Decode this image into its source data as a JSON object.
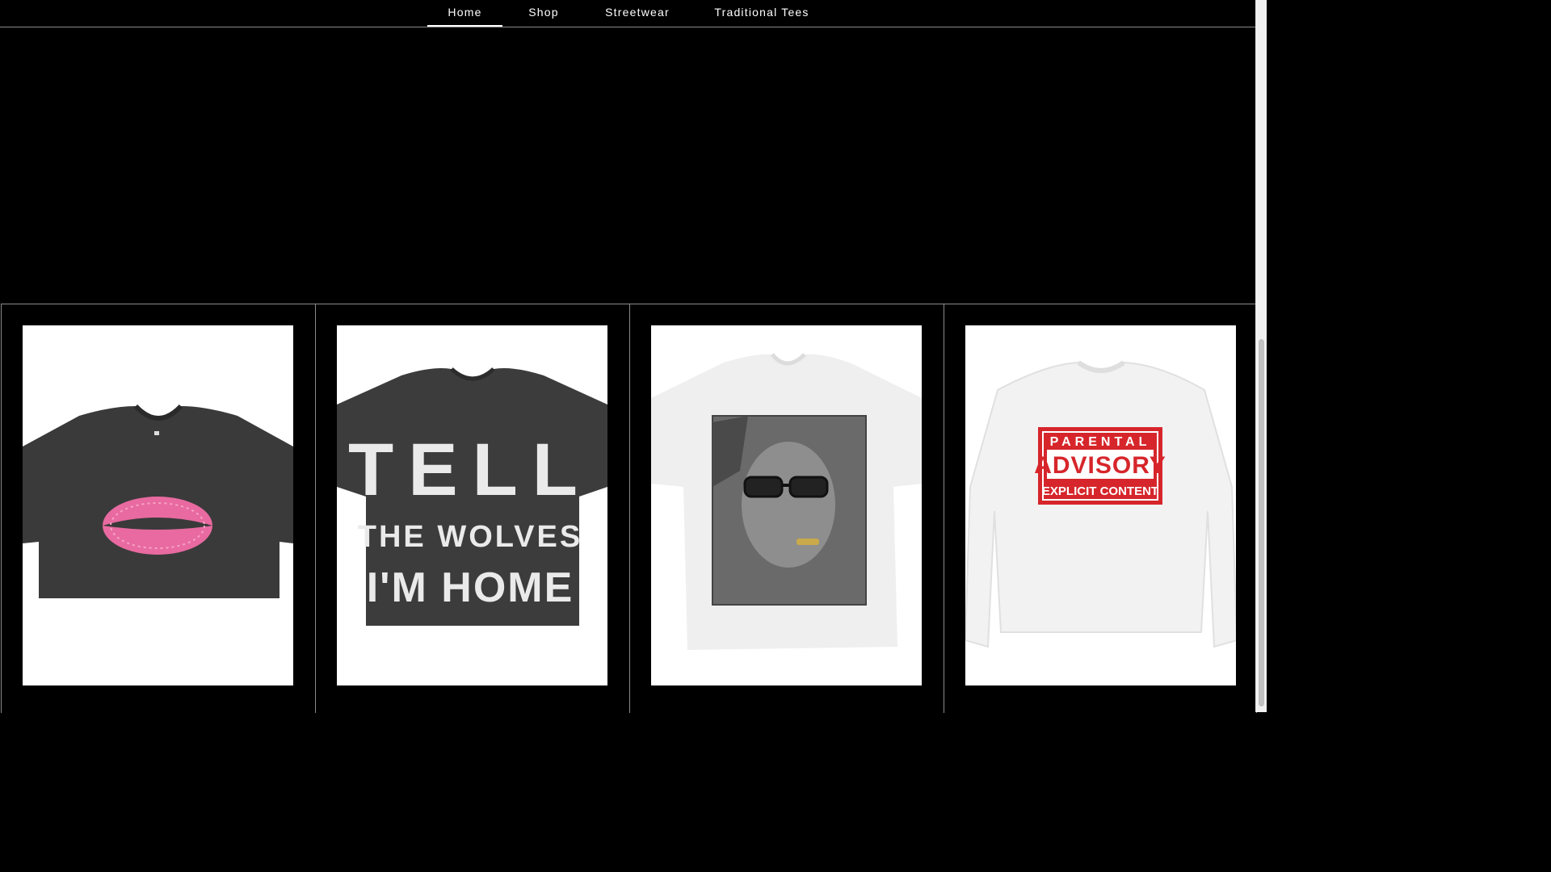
{
  "nav": {
    "items": [
      {
        "label": "Home",
        "active": true
      },
      {
        "label": "Shop",
        "active": false
      },
      {
        "label": "Streetwear",
        "active": false
      },
      {
        "label": "Traditional Tees",
        "active": false
      }
    ]
  },
  "products": [
    {
      "image": "charcoal-crop-tee-pink-lips-print"
    },
    {
      "image": "charcoal-tee-text-print",
      "print_lines": [
        "TELL",
        "THE WOLVES",
        "I'M HOME"
      ]
    },
    {
      "image": "white-tee-portrait-photo-print"
    },
    {
      "image": "white-sweatshirt-advisory-print",
      "print_lines": [
        "PARENTAL",
        "ADVISORY",
        "EXPLICIT CONTENT"
      ]
    }
  ],
  "colors": {
    "background": "#000000",
    "nav_text": "#ffffff",
    "divider": "#8a8a8a",
    "advisory_red": "#d6262b",
    "lips_pink": "#e86aa0"
  }
}
